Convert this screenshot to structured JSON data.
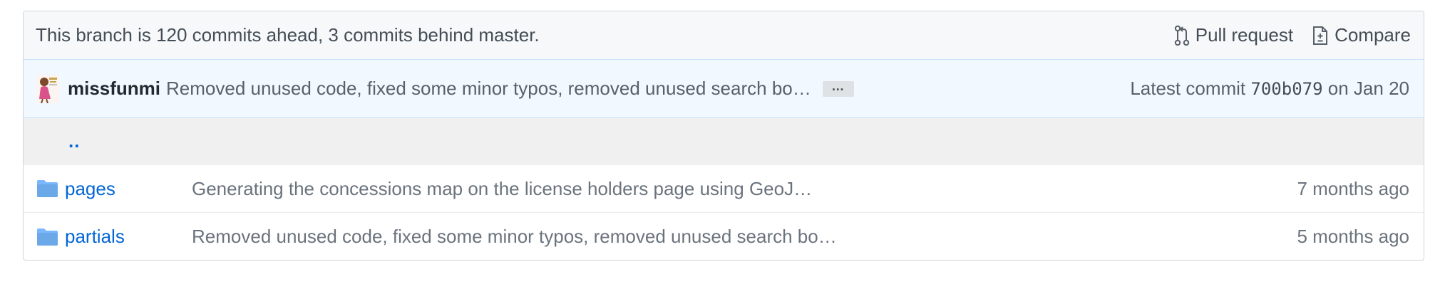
{
  "branch_bar": {
    "status_text": "This branch is 120 commits ahead, 3 commits behind master.",
    "pull_request_label": "Pull request",
    "compare_label": "Compare"
  },
  "latest_commit": {
    "author": "missfunmi",
    "message": "Removed unused code, fixed some minor typos, removed unused search bo…",
    "expand_label": "…",
    "prefix": "Latest commit",
    "sha": "700b079",
    "date": "on Jan 20"
  },
  "files": {
    "up_label": "..",
    "rows": [
      {
        "icon": "folder-icon",
        "name": "pages",
        "message": "Generating the concessions map on the license holders page using GeoJ…",
        "age": "7 months ago"
      },
      {
        "icon": "folder-icon",
        "name": "partials",
        "message": "Removed unused code, fixed some minor typos, removed unused search bo…",
        "age": "5 months ago"
      }
    ]
  },
  "colors": {
    "link": "#0366d6",
    "folder": "#79b8ff",
    "commit_bg": "#f1f8ff",
    "branch_bg": "#f6f8fa"
  }
}
